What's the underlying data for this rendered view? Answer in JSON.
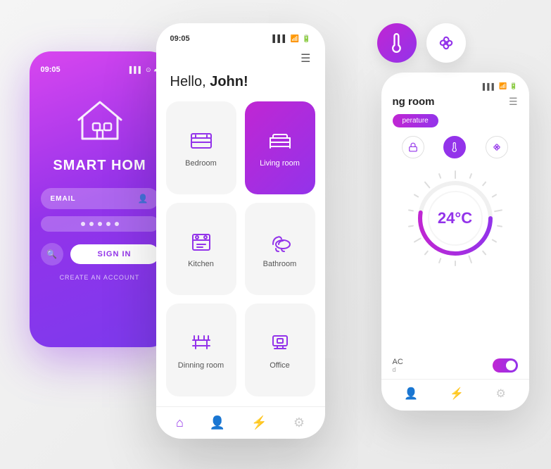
{
  "leftPhone": {
    "statusTime": "09:05",
    "brandName": "SMART HOM",
    "emailPlaceholder": "EMAIL",
    "signInLabel": "SIGN IN",
    "createAccount": "CREATE AN ACCOUNT"
  },
  "centerPhone": {
    "statusTime": "09:05",
    "greeting": "Hello, ",
    "userName": "John!",
    "menuIcon": "☰",
    "rooms": [
      {
        "id": "bedroom",
        "label": "Bedroom",
        "active": false
      },
      {
        "id": "living-room",
        "label": "Living room",
        "active": true
      },
      {
        "id": "kitchen",
        "label": "Kitchen",
        "active": false
      },
      {
        "id": "bathroom",
        "label": "Bathroom",
        "active": false
      },
      {
        "id": "dinning-room",
        "label": "Dinning room",
        "active": false
      },
      {
        "id": "office",
        "label": "Office",
        "active": false
      }
    ],
    "navItems": [
      "home",
      "person",
      "bolt",
      "settings"
    ]
  },
  "rightPhone": {
    "roomTitle": "ng room",
    "tempTab": "perature",
    "temperature": "24°C",
    "acLabel": "AC",
    "acSub": "d"
  },
  "floatingIcons": {
    "thermometer": "🌡",
    "fan": "⚙"
  },
  "colors": {
    "purple": "#9333ea",
    "pink": "#c026d3",
    "accent": "linear-gradient(135deg, #c026d3, #9333ea)"
  }
}
